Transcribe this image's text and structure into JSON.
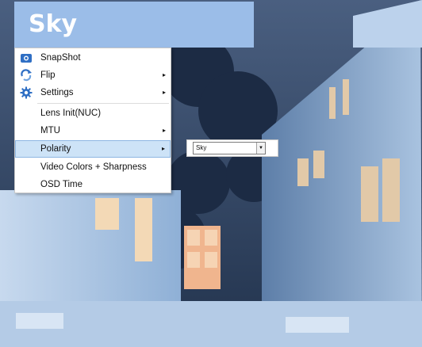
{
  "banner": {
    "title": "Sky"
  },
  "menu": {
    "items": [
      {
        "label": "SnapShot",
        "icon": "camera-icon",
        "has_submenu": false
      },
      {
        "label": "Flip",
        "icon": "flip-icon",
        "has_submenu": true
      },
      {
        "label": "Settings",
        "icon": "gear-icon",
        "has_submenu": true
      },
      {
        "label": "Lens Init(NUC)",
        "icon": "",
        "has_submenu": false
      },
      {
        "label": "MTU",
        "icon": "",
        "has_submenu": true
      },
      {
        "label": "Polarity",
        "icon": "",
        "has_submenu": true,
        "selected": true
      },
      {
        "label": "Video Colors + Sharpness",
        "icon": "",
        "has_submenu": false
      },
      {
        "label": "OSD Time",
        "icon": "",
        "has_submenu": false
      }
    ],
    "arrow_glyph": "▸"
  },
  "polarity_submenu": {
    "selected_value": "Sky"
  },
  "colors": {
    "banner": "#9bbde8",
    "selection": "#cde3f7",
    "icon_blue": "#2f6fc4"
  }
}
